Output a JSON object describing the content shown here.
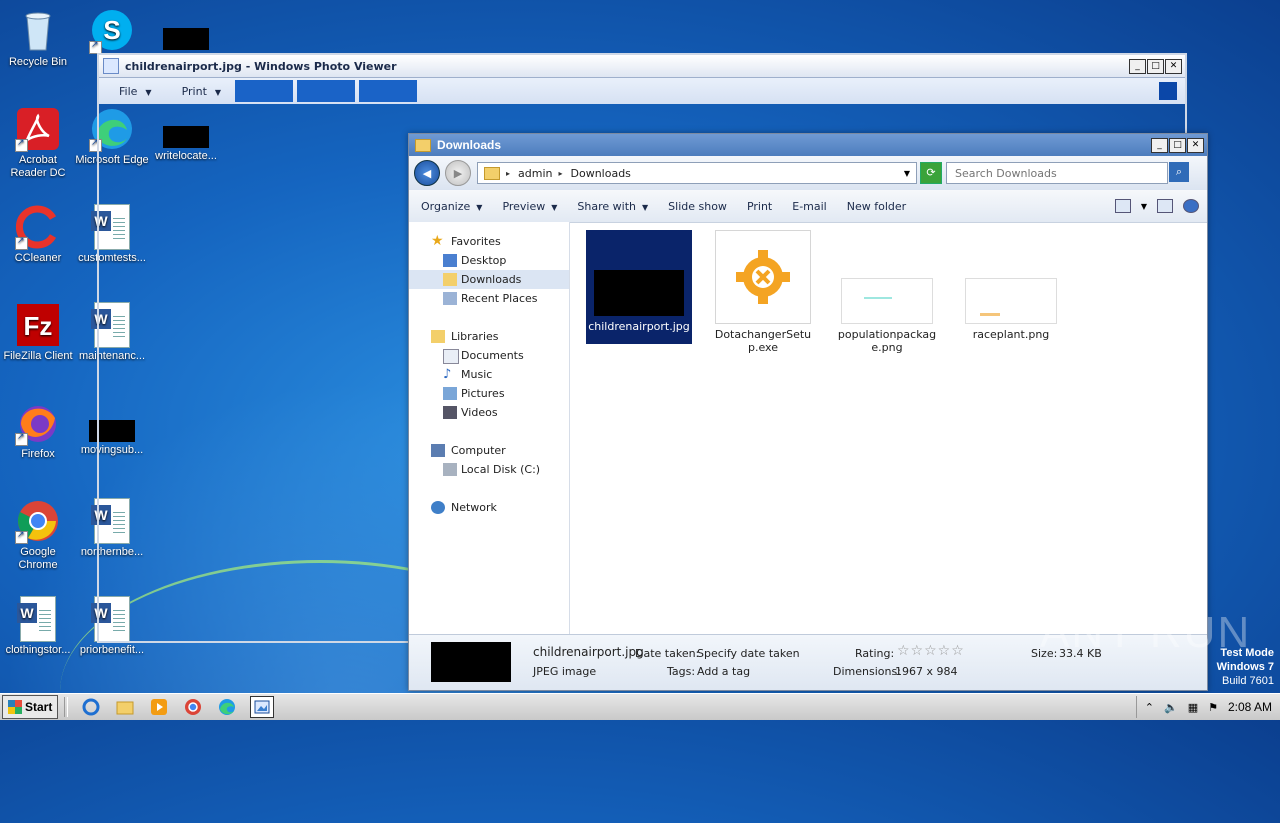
{
  "desktop": {
    "icons": [
      {
        "label": "Recycle Bin"
      },
      {
        "label": "Skype"
      },
      {
        "label": ""
      },
      {
        "label": "Acrobat Reader DC"
      },
      {
        "label": "Microsoft Edge"
      },
      {
        "label": "writelocate..."
      },
      {
        "label": "CCleaner"
      },
      {
        "label": "customtests..."
      },
      {
        "label": "FileZilla Client"
      },
      {
        "label": "maintenanc..."
      },
      {
        "label": "Firefox"
      },
      {
        "label": "movingsub..."
      },
      {
        "label": "Google Chrome"
      },
      {
        "label": "northernbe..."
      },
      {
        "label": "clothingstor..."
      },
      {
        "label": "priorbenefit..."
      }
    ]
  },
  "photo_viewer": {
    "title": "childrenairport.jpg - Windows Photo Viewer",
    "menu": {
      "file": "File",
      "print": "Print"
    },
    "controls": {
      "minimize": "_",
      "maximize": "□",
      "close": "✕"
    }
  },
  "explorer": {
    "title": "Downloads",
    "breadcrumb": [
      "admin",
      "Downloads"
    ],
    "search_placeholder": "Search Downloads",
    "toolbar": {
      "organize": "Organize",
      "preview": "Preview",
      "share_with": "Share with",
      "slide_show": "Slide show",
      "print": "Print",
      "email": "E-mail",
      "new_folder": "New folder"
    },
    "nav": {
      "favorites": "Favorites",
      "desktop": "Desktop",
      "downloads": "Downloads",
      "recent_places": "Recent Places",
      "libraries": "Libraries",
      "documents": "Documents",
      "music": "Music",
      "pictures": "Pictures",
      "videos": "Videos",
      "computer": "Computer",
      "local_disk": "Local Disk (C:)",
      "network": "Network"
    },
    "files": [
      {
        "name": "childrenairport.jpg"
      },
      {
        "name": "DotachangerSetup.exe"
      },
      {
        "name": "populationpackage.png"
      },
      {
        "name": "raceplant.png"
      }
    ],
    "details": {
      "filename": "childrenairport.jpg",
      "filetype": "JPEG image",
      "date_taken": "Date taken:",
      "date_taken_value": "Specify date taken",
      "tags": "Tags:",
      "tags_value": "Add a tag",
      "rating": "Rating:",
      "rating_stars": "☆☆☆☆☆",
      "dimensions": "Dimensions:",
      "dimensions_value": "1967 x 984",
      "size": "Size:",
      "size_value": "33.4 KB"
    }
  },
  "watermark": "ANY RUN",
  "test_mode": {
    "line1": "Test Mode",
    "line2": "Windows 7",
    "line3": "Build 7601"
  },
  "taskbar": {
    "start": "Start",
    "clock": "2:08 AM"
  }
}
